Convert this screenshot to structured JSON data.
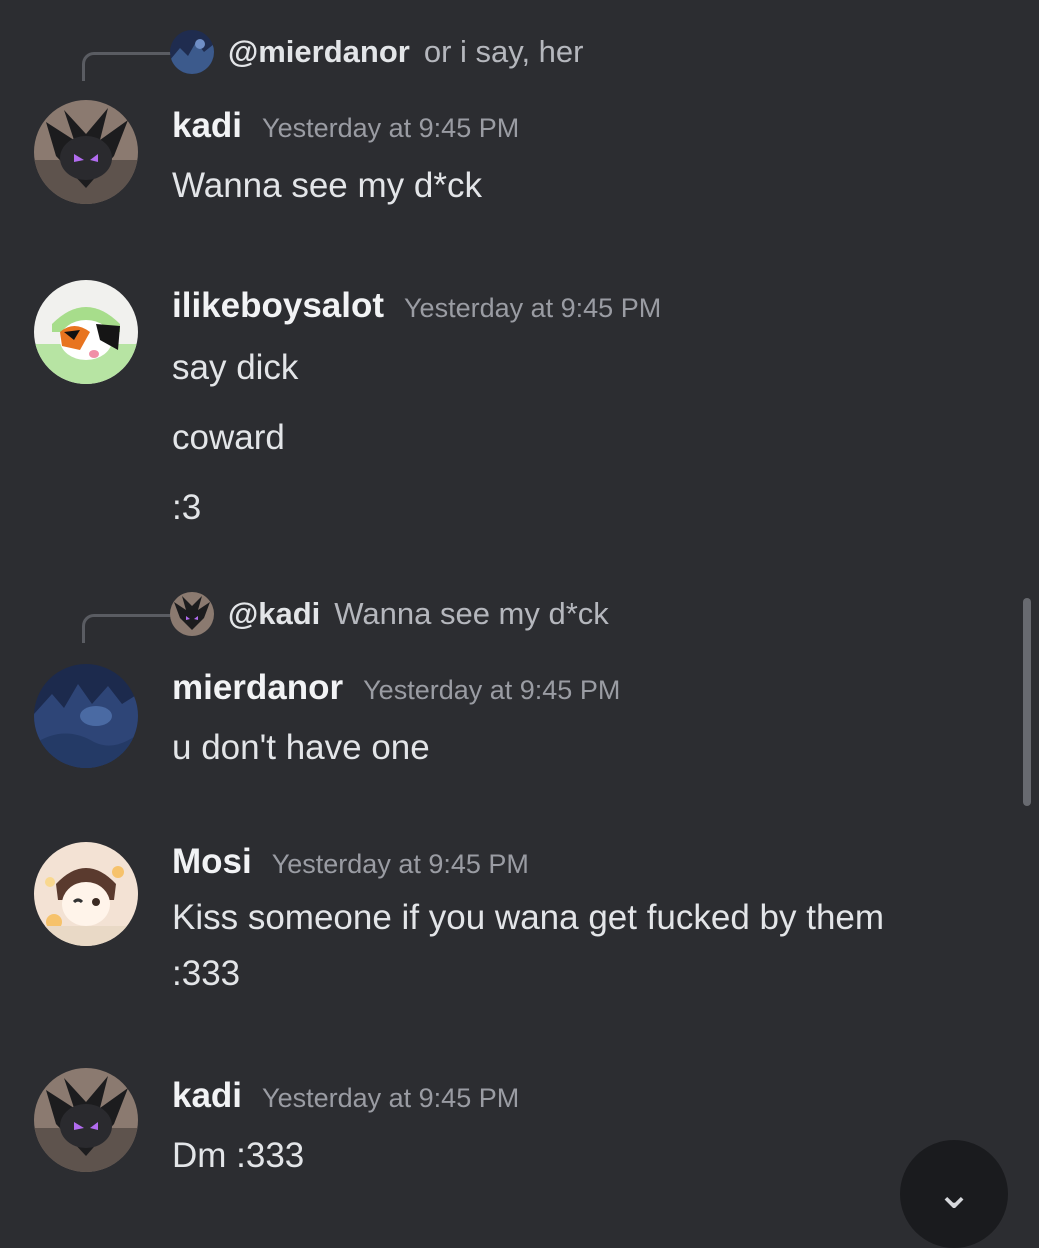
{
  "messages": [
    {
      "reply": {
        "name": "@mierdanor",
        "text": "or i say, her"
      },
      "author": "kadi",
      "timestamp": "Yesterday at 9:45 PM",
      "lines": [
        "Wanna see my d*ck"
      ]
    },
    {
      "author": "ilikeboysalot",
      "timestamp": "Yesterday at 9:45 PM",
      "lines": [
        "say dick",
        "coward",
        ":3"
      ]
    },
    {
      "reply": {
        "name": "@kadi",
        "text": "Wanna see my d*ck"
      },
      "author": "mierdanor",
      "timestamp": "Yesterday at 9:45 PM",
      "lines": [
        "u don't have one"
      ]
    },
    {
      "author": "Mosi",
      "timestamp": "Yesterday at 9:45 PM",
      "lines": [
        "Kiss someone if you wana get fucked by them",
        ":333"
      ]
    },
    {
      "author": "kadi",
      "timestamp": "Yesterday at 9:45 PM",
      "lines": [
        "Dm :333"
      ]
    }
  ],
  "jump_button": {
    "icon": "chevron-down-icon",
    "glyph": "⌄"
  },
  "colors": {
    "background": "#2c2d31",
    "username": "#f2f3f5",
    "timestamp": "#9a9ca3",
    "text": "#e3e5e8"
  }
}
